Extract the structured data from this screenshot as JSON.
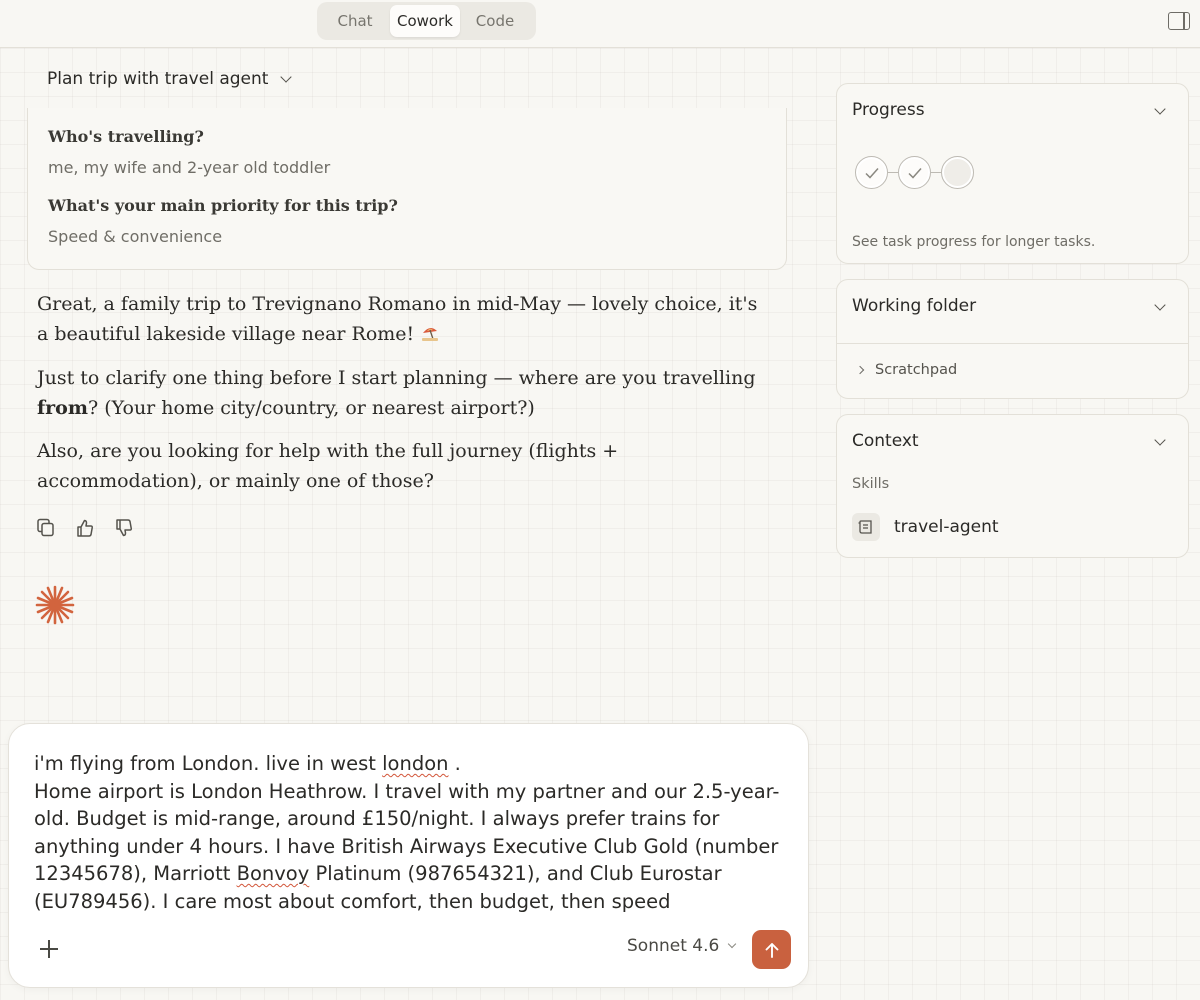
{
  "topbar": {
    "tabs": [
      "Chat",
      "Cowork",
      "Code"
    ],
    "active_tab": "Cowork"
  },
  "conversation": {
    "title": "Plan trip with travel agent"
  },
  "qa": {
    "q1": "Who's travelling?",
    "a1": "me, my wife and 2-year old toddler",
    "q2": "What's your main priority for this trip?",
    "a2": "Speed & convenience"
  },
  "assistant": {
    "p1": "Great, a family trip to Trevignano Romano in mid-May — lovely choice, it's a beautiful lakeside village near Rome!",
    "p2_start": "Just to clarify one thing before I start planning — where are you travelling ",
    "p2_bold": "from",
    "p2_end": "? (Your home city/country, or nearest airport?)",
    "p3": "Also, are you looking for help with the full journey (flights + accommodation), or mainly one of those?",
    "actions": [
      "copy-icon",
      "thumbs-up-icon",
      "thumbs-down-icon"
    ]
  },
  "composer": {
    "line1_start": "i'm flying from London. live in west ",
    "line1_misspelled": "london",
    "line1_end": " .",
    "body_start": "Home airport is London Heathrow. I travel with my partner and our 2.5-year-old. Budget is mid-range, around £150/night. I always prefer trains for anything under 4 hours. I have British Airways Executive Club Gold (number 12345678), Marriott ",
    "body_misspelled": "Bonvoy",
    "body_end": " Platinum (987654321), and Club Eurostar (EU789456). I care most about comfort, then budget, then speed",
    "model": "Sonnet 4.6"
  },
  "sidebar": {
    "progress": {
      "title": "Progress",
      "hint": "See task progress for longer tasks.",
      "steps": [
        "done",
        "done",
        "pending"
      ]
    },
    "working_folder": {
      "title": "Working folder",
      "folder": "Scratchpad"
    },
    "context": {
      "title": "Context",
      "skills_label": "Skills",
      "skill": "travel-agent"
    }
  },
  "colors": {
    "background": "#f8f7f3",
    "accent": "#c9613f",
    "spell_error": "#d2563a"
  }
}
